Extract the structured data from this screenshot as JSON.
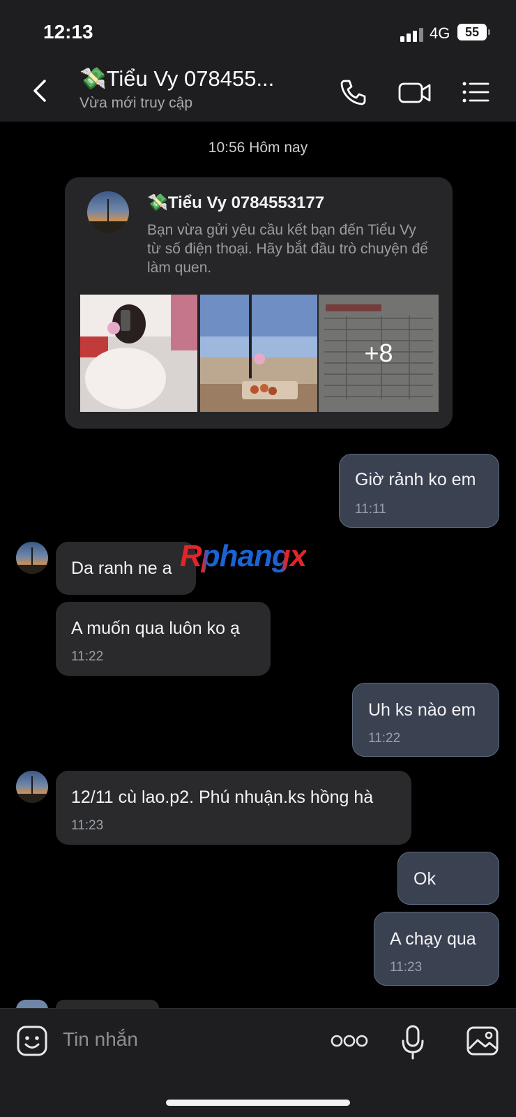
{
  "status": {
    "time": "12:13",
    "network": "4G",
    "battery": "55"
  },
  "header": {
    "contact_name": "💸Tiểu Vy 078455...",
    "status_text": "Vừa mới truy cập"
  },
  "chat": {
    "date_separator": "10:56 Hôm nay",
    "friend_card": {
      "name": "💸Tiểu Vy 0784553177",
      "description": "Bạn vừa gửi yêu cầu kết bạn đến Tiểu Vy từ số điện thoại. Hãy bắt đầu trò chuyện để làm quen.",
      "more_photos": "+8"
    },
    "messages": [
      {
        "from": "me",
        "text": "Giờ rảnh ko em",
        "time": "11:11"
      },
      {
        "from": "them",
        "text": "Da ranh ne a",
        "time": ""
      },
      {
        "from": "them",
        "text": "A muốn qua luôn ko ạ",
        "time": "11:22"
      },
      {
        "from": "me",
        "text": "Uh ks nào em",
        "time": "11:22"
      },
      {
        "from": "them",
        "text": "12/11 cù lao.p2. Phú nhuận.ks hồng hà",
        "time": "11:23"
      },
      {
        "from": "me",
        "text": "Ok",
        "time": ""
      },
      {
        "from": "me",
        "text": "A chạy qua",
        "time": "11:23"
      }
    ],
    "watermark": "Rphangx"
  },
  "input": {
    "placeholder": "Tin nhắn"
  },
  "icons": {
    "back": "back-chevron-icon",
    "call": "phone-icon",
    "video": "video-camera-icon",
    "menu": "menu-list-icon",
    "emoji": "emoji-sticker-icon",
    "more": "more-dots-icon",
    "mic": "microphone-icon",
    "image": "image-gallery-icon"
  },
  "colors": {
    "background": "#000000",
    "bar": "#1e1e20",
    "my_bubble": "#3a4252",
    "their_bubble": "#2a2a2c"
  }
}
